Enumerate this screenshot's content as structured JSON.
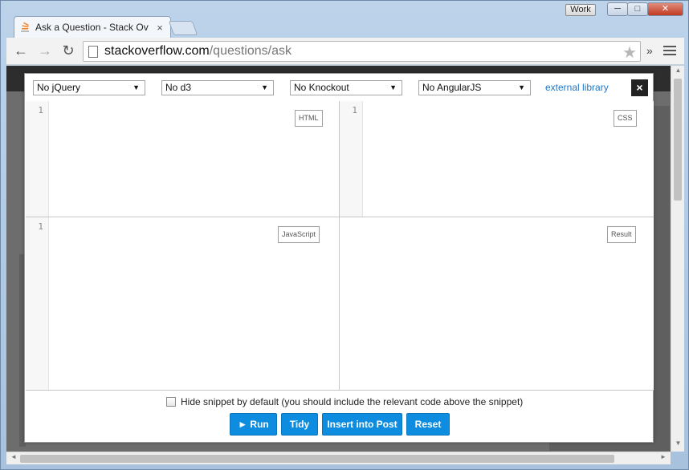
{
  "browser": {
    "profile_label": "Work",
    "tab_title": "Ask a Question - Stack Ov",
    "tab_close": "×",
    "url_host": "stackoverflow.com",
    "url_path": "/questions/ask",
    "window_min": "─",
    "window_max": "□",
    "window_close": "✕",
    "overflow_chevron": "»"
  },
  "snippet_editor": {
    "libraries": [
      "No jQuery",
      "No d3",
      "No Knockout",
      "No AngularJS"
    ],
    "external_library_label": "external library",
    "close_label": "×",
    "panes": {
      "html": {
        "label": "HTML",
        "line": "1"
      },
      "css": {
        "label": "CSS",
        "line": "1"
      },
      "javascript": {
        "label": "JavaScript",
        "line": "1"
      },
      "result": {
        "label": "Result"
      }
    },
    "hide_snippet_label": "Hide snippet by default (you should include the relevant code above the snippet)",
    "buttons": {
      "run": "► Run",
      "tidy": "Tidy",
      "insert": "Insert into Post",
      "reset": "Reset"
    }
  },
  "colors": {
    "accent_button": "#0e8de0",
    "link": "#2078c9",
    "overlay": "#6d6d6d"
  }
}
